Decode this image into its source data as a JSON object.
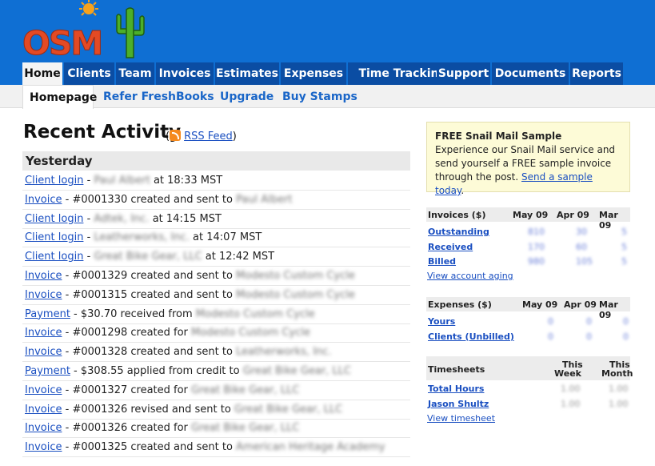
{
  "logo": {
    "text": "OSM"
  },
  "tabs": [
    "Home",
    "Clients",
    "Team",
    "Invoices",
    "Estimates",
    "Expenses",
    "Time Tracking",
    "Support",
    "Documents",
    "Reports"
  ],
  "subnav": [
    "Homepage",
    "Refer FreshBooks",
    "Upgrade",
    "Buy Stamps"
  ],
  "activity": {
    "title": "Recent Activity",
    "rss_open": "(",
    "rss_label": "RSS Feed",
    "rss_close": ")",
    "day": "Yesterday",
    "items": [
      {
        "link": "Client login",
        "sep": " - ",
        "blur": "Paul Albert",
        "text": " at 18:33 MST"
      },
      {
        "link": "Invoice",
        "sep": " - ",
        "text": "#0001330 created and sent to ",
        "blur": "Paul Albert"
      },
      {
        "link": "Client login",
        "sep": " - ",
        "blur": "Adtek, Inc.",
        "text": " at 14:15 MST"
      },
      {
        "link": "Client login",
        "sep": " - ",
        "blur": "Leatherworks, Inc.",
        "text": " at 14:07 MST"
      },
      {
        "link": "Client login",
        "sep": " - ",
        "blur": "Great Bike Gear, LLC",
        "text": " at 12:42 MST"
      },
      {
        "link": "Invoice",
        "sep": " - ",
        "text": "#0001329 created and sent to ",
        "blur": "Modesto Custom Cycle"
      },
      {
        "link": "Invoice",
        "sep": " - ",
        "text": "#0001315 created and sent to ",
        "blur": "Modesto Custom Cycle"
      },
      {
        "link": "Payment",
        "sep": " - ",
        "text": "$30.70 received from ",
        "blur": "Modesto Custom Cycle"
      },
      {
        "link": "Invoice",
        "sep": " - ",
        "text": "#0001298 created for ",
        "blur": "Modesto Custom Cycle"
      },
      {
        "link": "Invoice",
        "sep": " - ",
        "text": "#0001328 created and sent to ",
        "blur": "Leatherworks, Inc."
      },
      {
        "link": "Payment",
        "sep": " - ",
        "text": "$308.55 applied from credit to ",
        "blur": "Great Bike Gear, LLC"
      },
      {
        "link": "Invoice",
        "sep": " - ",
        "text": "#0001327 created for ",
        "blur": "Great Bike Gear, LLC"
      },
      {
        "link": "Invoice",
        "sep": " - ",
        "text": "#0001326 revised and sent to ",
        "blur": "Great Bike Gear, LLC"
      },
      {
        "link": "Invoice",
        "sep": " - ",
        "text": "#0001326 created for ",
        "blur": "Great Bike Gear, LLC"
      },
      {
        "link": "Invoice",
        "sep": " - ",
        "text": "#0001325 created and sent to ",
        "blur": "American Heritage Academy"
      }
    ]
  },
  "snail": {
    "title": "FREE Snail Mail Sample",
    "body": "Experience our Snail Mail service and send yourself a FREE sample invoice through the post.",
    "link": "Send a sample today",
    "end": "."
  },
  "invoices_box": {
    "title": "Invoices ($)",
    "months": [
      "May 09",
      "Apr 09",
      "Mar 09"
    ],
    "rows": [
      {
        "label": "Outstanding",
        "values": [
          "810",
          "30",
          "5"
        ]
      },
      {
        "label": "Received",
        "values": [
          "170",
          "60",
          "5"
        ]
      },
      {
        "label": "Billed",
        "values": [
          "980",
          "105",
          "5"
        ]
      }
    ],
    "link": "View account aging"
  },
  "expenses_box": {
    "title": "Expenses ($)",
    "months": [
      "May 09",
      "Apr 09",
      "Mar 09"
    ],
    "rows": [
      {
        "label": "Yours",
        "values": [
          "0",
          "0",
          "0"
        ]
      },
      {
        "label": "Clients (Unbilled)",
        "values": [
          "0",
          "0",
          "0"
        ]
      }
    ]
  },
  "timesheets_box": {
    "title": "Timesheets",
    "col1a": "This",
    "col1b": "Week",
    "col2a": "This",
    "col2b": "Month",
    "rows": [
      {
        "label": "Total Hours",
        "values": [
          "1.00",
          "1.00"
        ]
      },
      {
        "label": "Jason Shultz",
        "values": [
          "1.00",
          "1.00"
        ]
      }
    ],
    "link": "View timesheet"
  },
  "colors": {
    "header_blue": "#0f6fd3",
    "tab_blue": "#0b4da3",
    "link_blue": "#1a4fc1"
  }
}
